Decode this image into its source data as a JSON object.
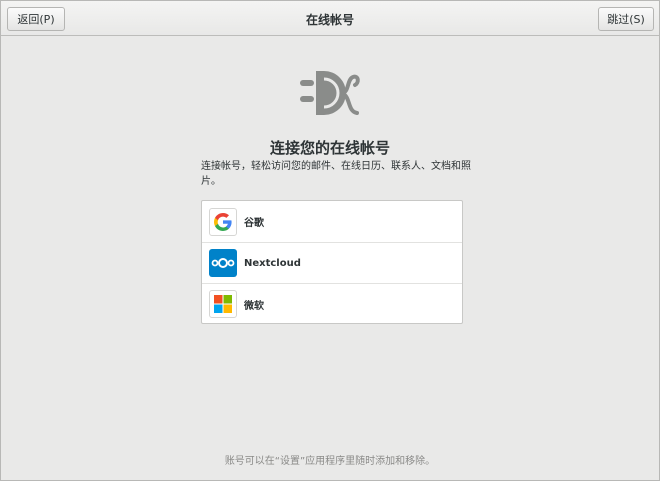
{
  "header": {
    "back_label": "返回(P)",
    "title": "在线帐号",
    "skip_label": "跳过(S)"
  },
  "main": {
    "hero_icon": "online-accounts-plug-icon",
    "heading": "连接您的在线帐号",
    "description": "连接帐号，轻松访问您的邮件、在线日历、联系人、文档和照片。",
    "providers": [
      {
        "label": "谷歌",
        "icon": "google-icon"
      },
      {
        "label": "Nextcloud",
        "icon": "nextcloud-icon"
      },
      {
        "label": "微软",
        "icon": "microsoft-icon"
      }
    ]
  },
  "footer": {
    "note": "账号可以在“设置”应用程序里随时添加和移除。"
  },
  "colors": {
    "background": "#e9e9e8",
    "nextcloud_blue": "#0082c9",
    "google_blue": "#4285f4",
    "google_red": "#ea4335",
    "google_yellow": "#fbbc05",
    "google_green": "#34a853",
    "ms_red": "#f25022",
    "ms_green": "#7fba00",
    "ms_blue": "#00a4ef",
    "ms_yellow": "#ffb900"
  }
}
